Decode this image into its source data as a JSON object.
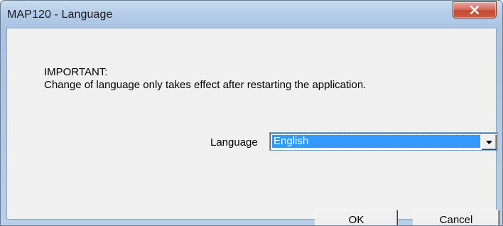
{
  "window": {
    "title": "MAP120 - Language",
    "close_icon": "close-x-icon"
  },
  "message": {
    "line1": "IMPORTANT:",
    "line2": "Change of language only takes effect after restarting the application."
  },
  "language": {
    "label": "Language",
    "selected": "English",
    "dropdown_icon": "chevron-down-icon"
  },
  "buttons": {
    "ok": "OK",
    "cancel": "Cancel"
  },
  "colors": {
    "selection": "#3399ff",
    "close_button": "#c44a33",
    "client_bg": "#f0f0f0"
  }
}
